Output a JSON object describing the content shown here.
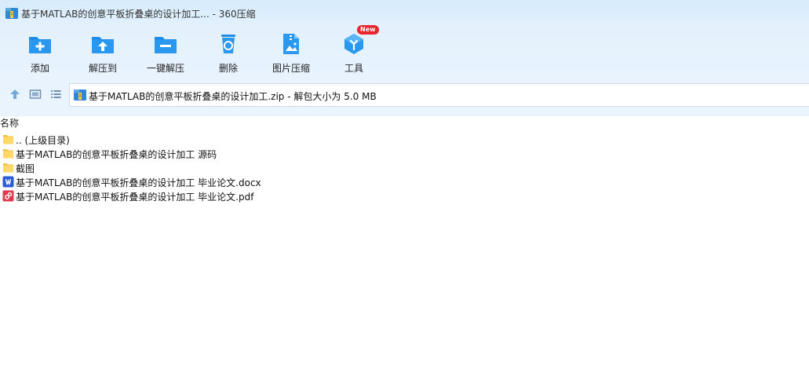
{
  "window": {
    "title": "基于MATLAB的创意平板折叠桌的设计加工... - 360压缩"
  },
  "toolbar": {
    "items": [
      {
        "label": "添加"
      },
      {
        "label": "解压到"
      },
      {
        "label": "一键解压"
      },
      {
        "label": "删除"
      },
      {
        "label": "图片压缩"
      },
      {
        "label": "工具",
        "badge": "New"
      }
    ]
  },
  "address": {
    "text": "基于MATLAB的创意平板折叠桌的设计加工.zip - 解包大小为 5.0 MB"
  },
  "list": {
    "header": "名称",
    "rows": [
      {
        "name": ".. (上级目录)",
        "icon": "folder-icon"
      },
      {
        "name": "基于MATLAB的创意平板折叠桌的设计加工 源码",
        "icon": "folder-icon"
      },
      {
        "name": "截图",
        "icon": "folder-icon"
      },
      {
        "name": "基于MATLAB的创意平板折叠桌的设计加工 毕业论文.docx",
        "icon": "word-icon"
      },
      {
        "name": "基于MATLAB的创意平板折叠桌的设计加工 毕业论文.pdf",
        "icon": "pdf-icon"
      }
    ]
  },
  "colors": {
    "accent": "#1e8ce8",
    "badge": "#e7262d",
    "folder": "#ffd86a"
  }
}
